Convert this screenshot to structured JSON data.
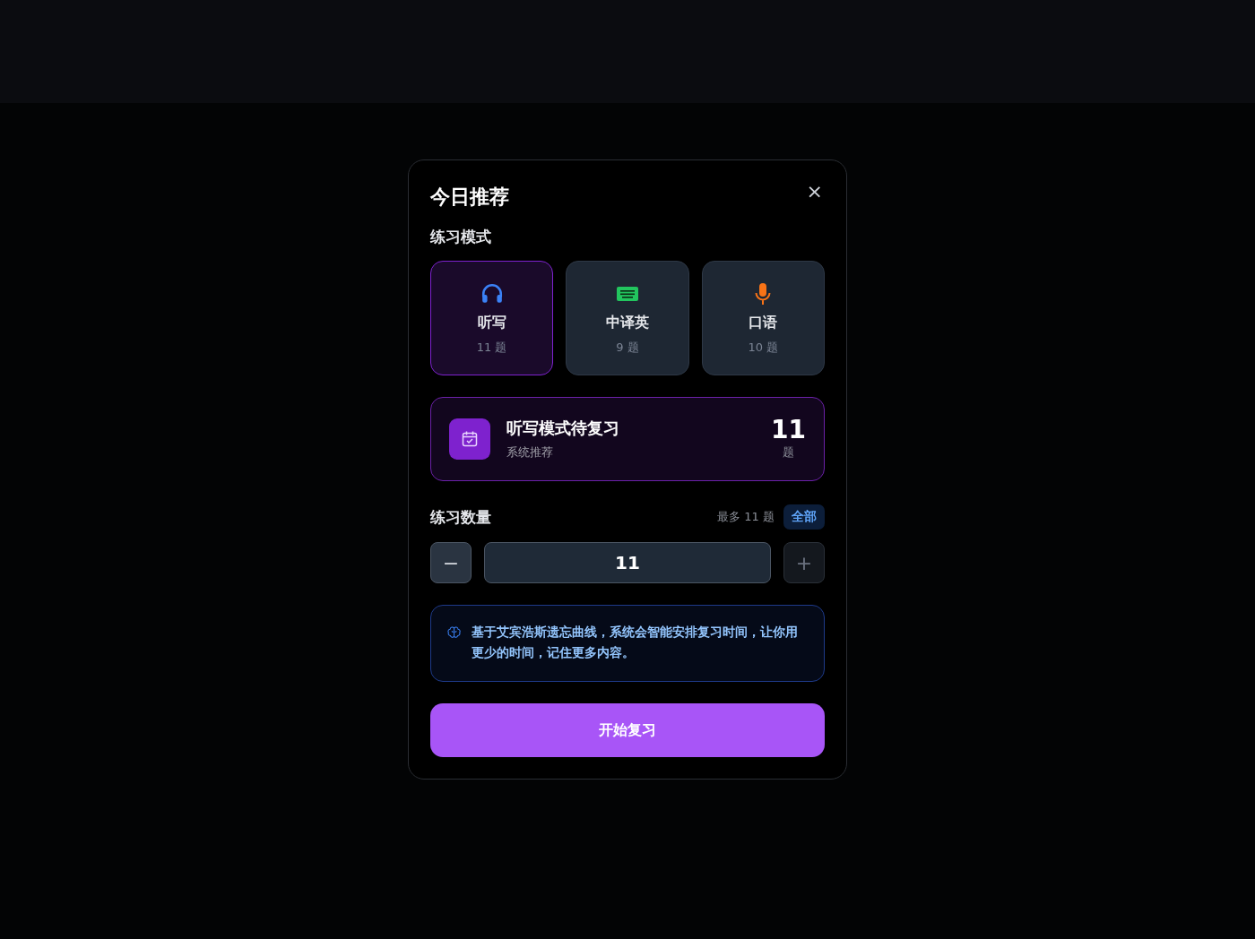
{
  "dialog": {
    "title": "今日推荐",
    "close": "×",
    "mode_section": {
      "label": "练习模式",
      "modes": [
        {
          "kind": "listen",
          "name": "听写",
          "count": "11 题",
          "selected": true
        },
        {
          "kind": "translate",
          "name": "中译英",
          "count": "9 题",
          "selected": false
        },
        {
          "kind": "speak",
          "name": "口语",
          "count": "10 题",
          "selected": false
        }
      ]
    },
    "recommendation": {
      "title": "听写模式待复习",
      "subtitle": "系统推荐",
      "number": "11",
      "unit": "题"
    },
    "quantity": {
      "label": "练习数量",
      "max_hint": "最多 11 题",
      "all_button": "全部",
      "value": "11",
      "decrement": {
        "symbol": "−",
        "disabled": false
      },
      "increment": {
        "symbol": "+",
        "disabled": true
      }
    },
    "info": "基于艾宾浩斯遗忘曲线，系统会智能安排复习时间，让你用更少的时间，记住更多内容。",
    "start_button": "开始复习"
  }
}
